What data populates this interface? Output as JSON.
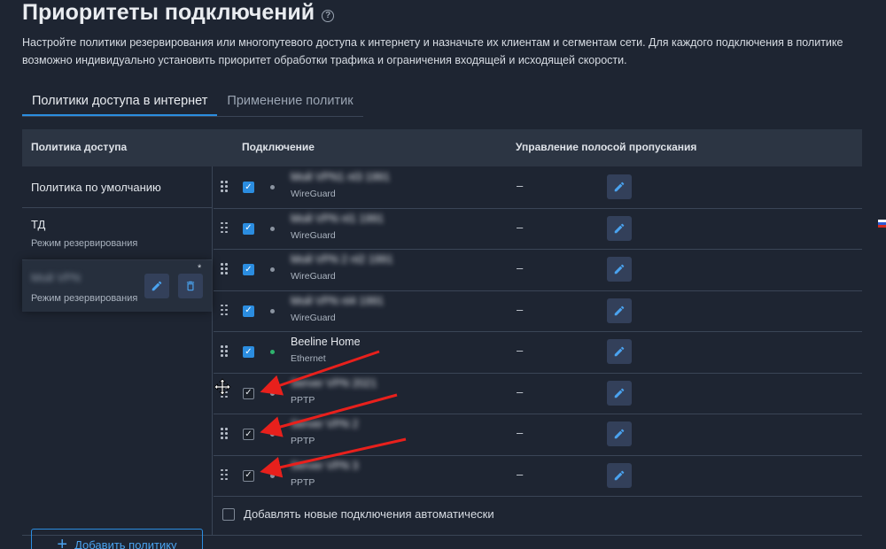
{
  "header": {
    "title": "Приоритеты подключений",
    "help_icon": "question-circle-icon",
    "description": "Настройте политики резервирования или многопутевого доступа к интернету и назначьте их клиентам и сегментам сети. Для каждого подключения в политике возможно индивидуально установить приоритет обработки трафика и ограничения входящей и исходящей скорости."
  },
  "tabs": [
    {
      "label": "Политики доступа в интернет",
      "active": true
    },
    {
      "label": "Применение политик",
      "active": false
    }
  ],
  "table": {
    "headers": {
      "policy": "Политика доступа",
      "connection": "Подключение",
      "bandwidth": "Управление полосой пропускания"
    }
  },
  "policies": [
    {
      "name": "Политика по умолчанию",
      "mode": ""
    },
    {
      "name": "ТД",
      "mode": "Режим резервирования"
    },
    {
      "name": "Мой VPN",
      "mode": "Режим резервирования",
      "name_blurred": true,
      "asterisk": "*"
    }
  ],
  "connections": [
    {
      "name": "Мой VPN1 nl3 1991",
      "type": "WireGuard",
      "checked": true,
      "status_color": "#8a93a0",
      "bandwidth": "–",
      "name_blurred": true
    },
    {
      "name": "Мой VPN nl1 1991",
      "type": "WireGuard",
      "checked": true,
      "status_color": "#8a93a0",
      "bandwidth": "–",
      "name_blurred": true
    },
    {
      "name": "Мой VPN 2 nl2 1991",
      "type": "WireGuard",
      "checked": true,
      "status_color": "#8a93a0",
      "bandwidth": "–",
      "name_blurred": true
    },
    {
      "name": "Мой VPN nl4 1991",
      "type": "WireGuard",
      "checked": true,
      "status_color": "#8a93a0",
      "bandwidth": "–",
      "name_blurred": true
    },
    {
      "name": "Beeline Home",
      "type": "Ethernet",
      "checked": true,
      "status_color": "#2fb36d",
      "bandwidth": "–",
      "name_blurred": false
    },
    {
      "name": "Server VPN 2021",
      "type": "PPTP",
      "checked": true,
      "status_color": "#8a93a0",
      "bandwidth": "–",
      "name_blurred": true
    },
    {
      "name": "Server VPN 2",
      "type": "PPTP",
      "checked": true,
      "status_color": "#8a93a0",
      "bandwidth": "–",
      "name_blurred": true
    },
    {
      "name": "Server VPN 3",
      "type": "PPTP",
      "checked": true,
      "status_color": "#8a93a0",
      "bandwidth": "–",
      "name_blurred": true
    }
  ],
  "actions": {
    "add_policy": "Добавить политику",
    "auto_add": "Добавлять новые подключения автоматически"
  },
  "colors": {
    "background": "#1e2532",
    "accent": "#2b8de0",
    "annotation_arrow": "#e8201c"
  }
}
